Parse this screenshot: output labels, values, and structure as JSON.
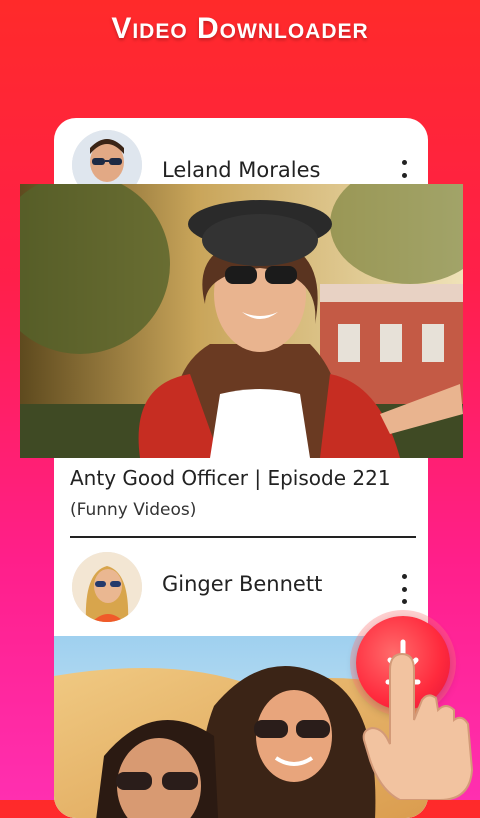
{
  "app": {
    "title": "Video Downloader"
  },
  "feed": {
    "posts": [
      {
        "author": "Leland Morales"
      },
      {
        "author": "Ginger Bennett"
      }
    ],
    "featured": {
      "title": "Anty Good Officer | Episode 221",
      "category": "(Funny Videos)"
    }
  },
  "icons": {
    "more": "vertical-dots-icon",
    "download": "download-arrow-icon"
  },
  "colors": {
    "background_top": "#ff2a2a",
    "background_bottom": "#ff2fb0",
    "card": "#ffffff",
    "download_button": "#ff2a3d"
  }
}
